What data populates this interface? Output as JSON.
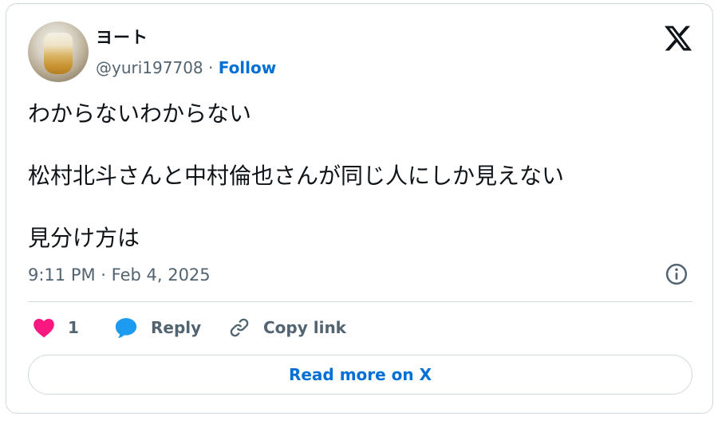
{
  "author": {
    "display_name": "ヨート",
    "handle": "@yuri197708",
    "separator": " · ",
    "follow_label": "Follow"
  },
  "tweet": {
    "paragraphs": [
      "わからないわからない",
      "松村北斗さんと中村倫也さんが同じ人にしか見えない",
      "見分け方は"
    ],
    "timestamp": "9:11 PM · Feb 4, 2025"
  },
  "actions": {
    "like_count": "1",
    "reply_label": "Reply",
    "copy_link_label": "Copy link"
  },
  "read_more_label": "Read more on X",
  "icons": {
    "brand": "x-logo-icon",
    "info": "info-icon",
    "like": "heart-icon",
    "reply": "speech-bubble-icon",
    "copy": "link-icon"
  },
  "colors": {
    "like": "#f91880",
    "reply": "#1d9bf0",
    "link": "#006fd6",
    "secondary_text": "#536471",
    "border": "#cfd9de"
  }
}
